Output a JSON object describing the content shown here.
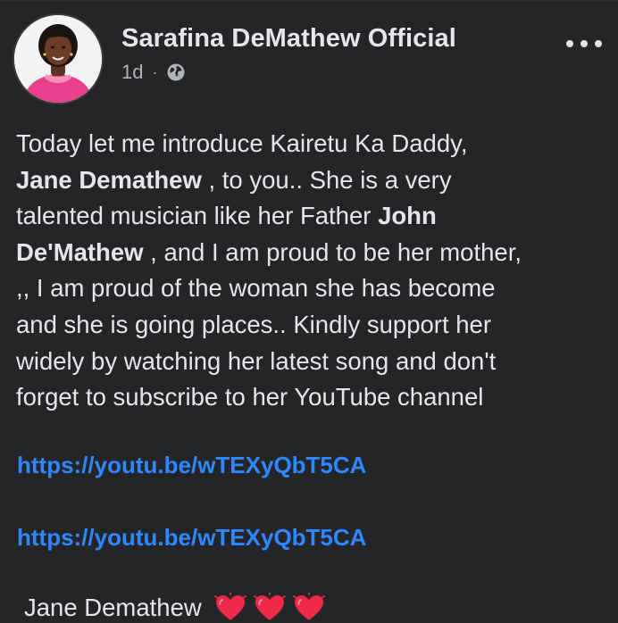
{
  "post": {
    "author_name": "Sarafina DeMathew Official",
    "time_ago": "1d",
    "separator": "·",
    "audience_icon": "globe-icon",
    "more_icon": "more-options-icon",
    "body": {
      "l1": "Today let me introduce Kairetu Ka Daddy,",
      "l2_bold": "Jane Demathew",
      "l2_rest": " , to you.. She is a very",
      "l3_pre": "talented musician like her Father ",
      "l3_bold": "John",
      "l4_bold": "De'Mathew",
      "l4_rest": " , and I am proud to be her mother,",
      "l5": ",, I am proud of the woman she has become",
      "l6": "and she is going places.. Kindly support her",
      "l7": "widely by watching her latest song and don't",
      "l8": "forget to subscribe to  her YouTube channel"
    },
    "links": [
      "https://youtu.be/wTEXyQbT5CA",
      "https://youtu.be/wTEXyQbT5CA"
    ],
    "signoff": "Jane Demathew",
    "signoff_emoji": [
      "heart-icon",
      "heart-icon",
      "heart-icon"
    ],
    "colors": {
      "background": "#242526",
      "text": "#e4e6eb",
      "secondary": "#b0b3b8",
      "link": "#2d88ff",
      "heart": "#f0284a"
    }
  }
}
